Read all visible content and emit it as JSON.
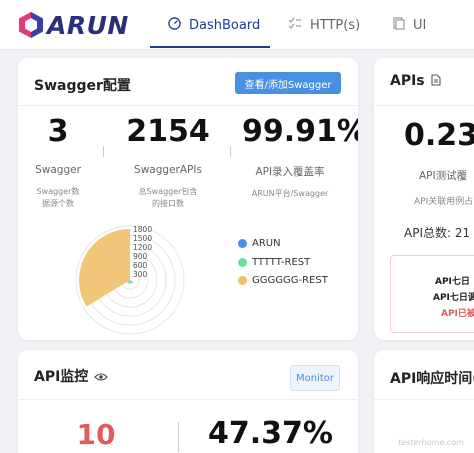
{
  "brand": {
    "name": "ARUN"
  },
  "nav": {
    "tabs": [
      {
        "label": "DashBoard",
        "icon": "dashboard-gauge-icon",
        "active": true
      },
      {
        "label": "HTTP(s)",
        "icon": "checklist-icon",
        "active": false
      },
      {
        "label": "UI",
        "icon": "pages-icon",
        "active": false
      }
    ]
  },
  "swagger_card": {
    "title": "Swagger配置",
    "button": "查看/添加Swagger",
    "stats": [
      {
        "value": "3",
        "label": "Swagger",
        "sub": "Swagger数\n据源个数"
      },
      {
        "value": "2154",
        "label": "SwaggerAPIs",
        "sub": "总Swagger包含\n的接口数"
      },
      {
        "value": "99.91%",
        "label": "API录入覆盖率",
        "sub": "ARUN平台/Swagger"
      }
    ]
  },
  "apis_card": {
    "title": "APIs",
    "value": "0.23",
    "label": "API测试覆",
    "sub": "API关联用例占",
    "total_label": "API总数: 21",
    "warnings": [
      "API七日",
      "API七日调",
      "API已被"
    ]
  },
  "monitor_card": {
    "title": "API监控",
    "button": "Monitor",
    "stats": [
      {
        "value": "10"
      },
      {
        "value": "47.37%"
      }
    ]
  },
  "response_card": {
    "title": "API响应时间(秒"
  },
  "watermark": "testerhome.com",
  "chart_data": {
    "type": "polar-bar",
    "radial_ticks": [
      "1800",
      "1500",
      "1200",
      "900",
      "600",
      "300"
    ],
    "radial_max": 1800,
    "series": [
      {
        "name": "ARUN",
        "color": "#4a90e2",
        "value": 0
      },
      {
        "name": "TTTTT-REST",
        "color": "#6fdca0",
        "value": 120
      },
      {
        "name": "GGGGGG-REST",
        "color": "#f0c06a",
        "value": 1700
      }
    ]
  },
  "colors": {
    "accent": "#1f3a93",
    "button": "#4a90e2",
    "danger": "#e05c5c"
  }
}
